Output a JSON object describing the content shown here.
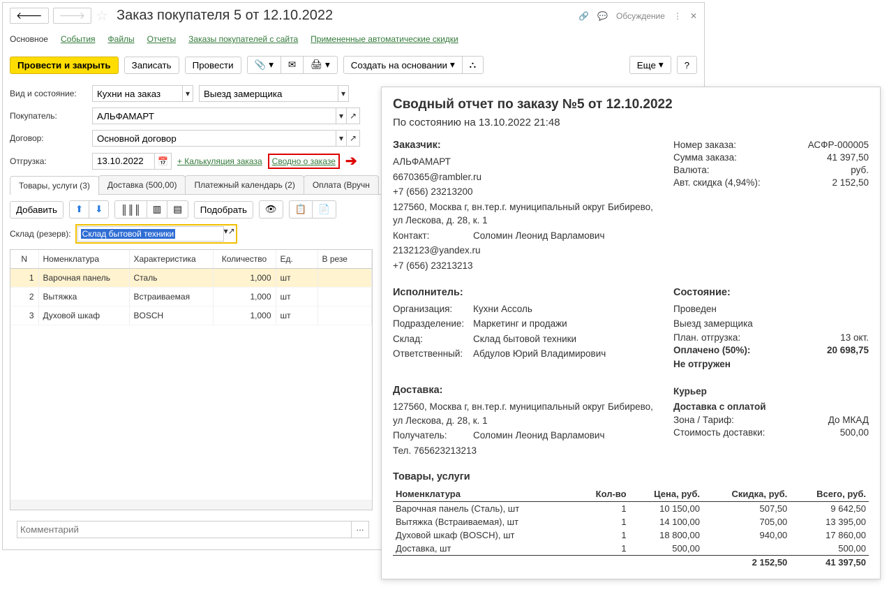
{
  "header": {
    "title": "Заказ покупателя 5 от 12.10.2022",
    "discussion": "Обсуждение"
  },
  "nav_tabs": {
    "main": "Основное",
    "events": "События",
    "files": "Файлы",
    "reports": "Отчеты",
    "site_orders": "Заказы покупателей с сайта",
    "discounts": "Примененные автоматические скидки"
  },
  "toolbar": {
    "post_close": "Провести и закрыть",
    "save": "Записать",
    "post": "Провести",
    "create_based": "Создать на основании",
    "more": "Еще"
  },
  "form": {
    "kind_label": "Вид и состояние:",
    "kind_value": "Кухни на заказ",
    "state_value": "Выезд замерщика",
    "buyer_label": "Покупатель:",
    "buyer_value": "АЛЬФАМАРТ",
    "contract_label": "Договор:",
    "contract_value": "Основной договор",
    "ship_label": "Отгрузка:",
    "ship_date": "13.10.2022",
    "calc_link": "+ Калькуляция заказа",
    "summary_link": "Сводно о заказе"
  },
  "doc_tabs": {
    "goods": "Товары, услуги (3)",
    "delivery": "Доставка (500,00)",
    "payment": "Платежный календарь (2)",
    "pay_manual": "Оплата (Вручн"
  },
  "tb2": {
    "add": "Добавить",
    "pick": "Подобрать"
  },
  "warehouse": {
    "label": "Склад (резерв):",
    "value": "Склад бытовой техники"
  },
  "grid": {
    "cols": {
      "n": "N",
      "nom": "Номенклатура",
      "char": "Характеристика",
      "qty": "Количество",
      "unit": "Ед.",
      "res": "В резе"
    },
    "rows": [
      {
        "n": "1",
        "nom": "Варочная панель",
        "char": "Сталь",
        "qty": "1,000",
        "unit": "шт"
      },
      {
        "n": "2",
        "nom": "Вытяжка",
        "char": "Встраиваемая",
        "qty": "1,000",
        "unit": "шт"
      },
      {
        "n": "3",
        "nom": "Духовой шкаф",
        "char": "BOSCH",
        "qty": "1,000",
        "unit": "шт"
      }
    ]
  },
  "comment": {
    "placeholder": "Комментарий"
  },
  "report": {
    "title": "Сводный отчет по заказу №5 от 12.10.2022",
    "asof": "По состоянию на 13.10.2022 21:48",
    "customer": {
      "h": "Заказчик:",
      "name": "АЛЬФАМАРТ",
      "email": "6670365@rambler.ru",
      "phone": "+7 (656) 23213200",
      "addr": "127560, Москва г, вн.тер.г. муниципальный округ Бибирево, ул Лескова, д. 28, к. 1",
      "contact_l": "Контакт:",
      "contact_v": "Соломин Леонид Варламович",
      "email2": "2132123@yandex.ru",
      "phone2": "+7 (656) 23213213"
    },
    "order_info": {
      "num_l": "Номер заказа:",
      "num_v": "АСФР-000005",
      "sum_l": "Сумма заказа:",
      "sum_v": "41 397,50",
      "cur_l": "Валюта:",
      "cur_v": "руб.",
      "disc_l": "Авт. скидка (4,94%):",
      "disc_v": "2 152,50"
    },
    "executor": {
      "h": "Исполнитель:",
      "org_l": "Организация:",
      "org_v": "Кухни Ассоль",
      "dept_l": "Подразделение:",
      "dept_v": "Маркетинг и продажи",
      "wh_l": "Склад:",
      "wh_v": "Склад бытовой техники",
      "resp_l": "Ответственный:",
      "resp_v": "Абдулов Юрий Владимирович"
    },
    "state": {
      "h": "Состояние:",
      "posted": "Проведен",
      "stage": "Выезд замерщика",
      "plan_l": "План. отгрузка:",
      "plan_v": "13 окт.",
      "paid_l": "Оплачено (50%):",
      "paid_v": "20 698,75",
      "notshipped": "Не отгружен"
    },
    "delivery": {
      "h": "Доставка:",
      "addr": "127560, Москва г, вн.тер.г. муниципальный округ Бибирево, ул Лескова, д. 28, к. 1",
      "recv_l": "Получатель:",
      "recv_v": "Соломин Леонид Варламович",
      "tel": "Тел. 765623213213",
      "courier": "Курьер",
      "paid": "Доставка с оплатой",
      "zone_l": "Зона / Тариф:",
      "zone_v": "До МКАД",
      "cost_l": "Стоимость доставки:",
      "cost_v": "500,00"
    },
    "items": {
      "h": "Товары, услуги",
      "cols": {
        "nom": "Номенклатура",
        "qty": "Кол-во",
        "price": "Цена, руб.",
        "disc": "Скидка, руб.",
        "total": "Всего, руб."
      },
      "rows": [
        {
          "nom": "Варочная панель (Сталь), шт",
          "qty": "1",
          "price": "10 150,00",
          "disc": "507,50",
          "total": "9 642,50"
        },
        {
          "nom": "Вытяжка (Встраиваемая), шт",
          "qty": "1",
          "price": "14 100,00",
          "disc": "705,00",
          "total": "13 395,00"
        },
        {
          "nom": "Духовой шкаф (BOSCH), шт",
          "qty": "1",
          "price": "18 800,00",
          "disc": "940,00",
          "total": "17 860,00"
        },
        {
          "nom": "Доставка, шт",
          "qty": "1",
          "price": "500,00",
          "disc": "",
          "total": "500,00"
        }
      ],
      "tot_disc": "2 152,50",
      "tot_sum": "41 397,50"
    }
  }
}
